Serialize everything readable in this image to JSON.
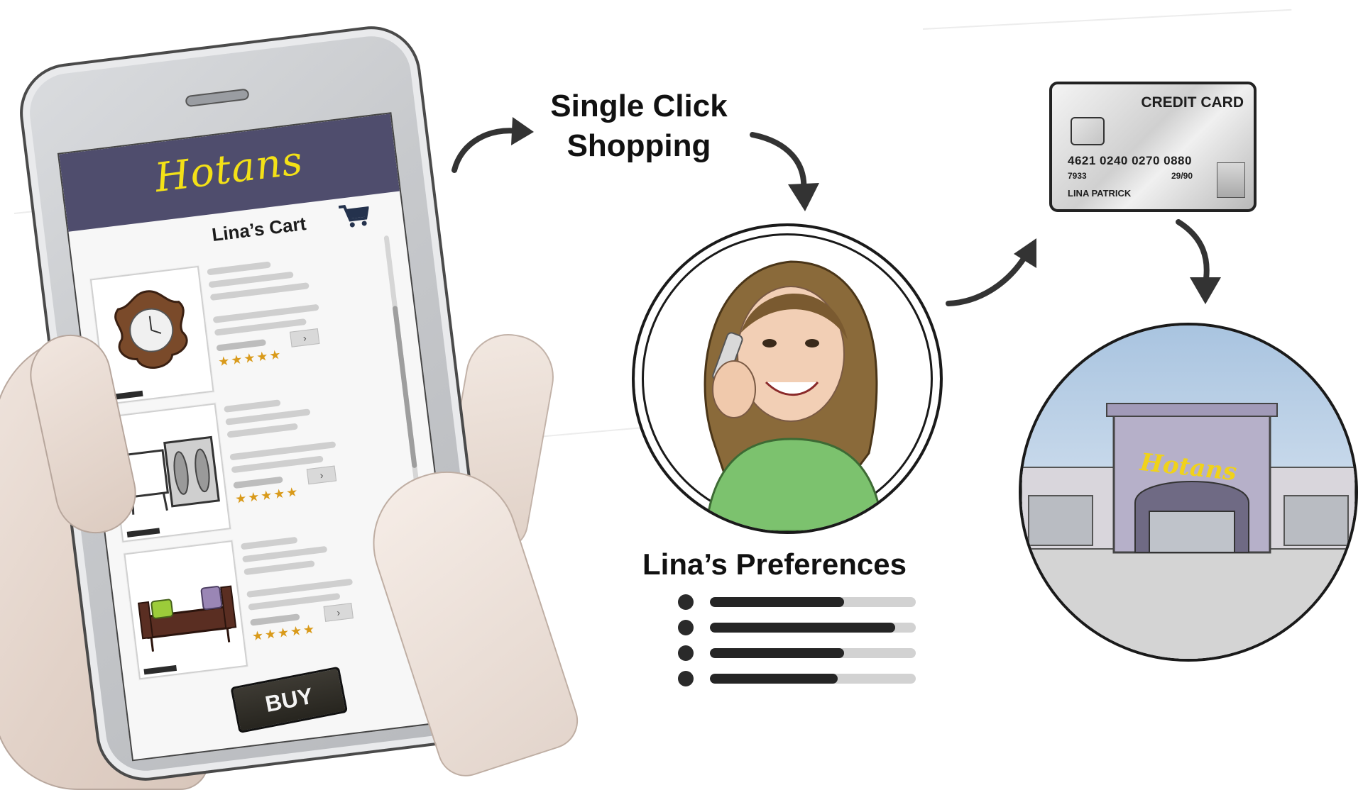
{
  "phone_app": {
    "brand": "Hotans",
    "cart_title": "Lina’s Cart",
    "items": [
      {
        "product": "ornate-wall-clock",
        "rating": "★★★★★"
      },
      {
        "product": "mirrored-side-cabinet",
        "rating": "★★★★★"
      },
      {
        "product": "upholstered-bench",
        "rating": "★★★★★"
      }
    ],
    "buy_label": "BUY",
    "arrow_glyph": "›"
  },
  "flow": {
    "title_line1": "Single Click",
    "title_line2": "Shopping"
  },
  "preferences": {
    "title": "Lina’s Preferences",
    "levels": [
      0.65,
      0.9,
      0.65,
      0.62
    ]
  },
  "credit_card": {
    "label": "CREDIT CARD",
    "number": "4621 0240 0270 0880",
    "code": "7933",
    "expiry": "29/90",
    "holder": "LINA PATRICK"
  },
  "store": {
    "sign": "Hotans"
  },
  "colors": {
    "header_purple": "#4f4d6d",
    "brand_yellow": "#f3e117",
    "star_orange": "#d99a1a",
    "shirt_green": "#7cc26e"
  }
}
